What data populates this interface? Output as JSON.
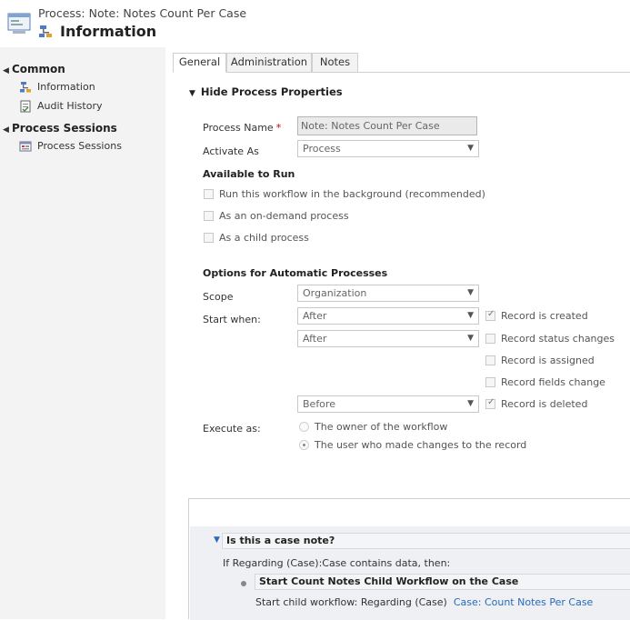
{
  "header": {
    "kicker": "Process: Note: Notes Count Per Case",
    "title": "Information"
  },
  "sidebar": {
    "groups": [
      {
        "label": "Common",
        "items": [
          {
            "label": "Information",
            "icon": "process-icon"
          },
          {
            "label": "Audit History",
            "icon": "audit-history-icon"
          }
        ]
      },
      {
        "label": "Process Sessions",
        "items": [
          {
            "label": "Process Sessions",
            "icon": "process-sessions-icon"
          }
        ]
      }
    ]
  },
  "tabs": [
    {
      "label": "General",
      "active": true
    },
    {
      "label": "Administration",
      "active": false
    },
    {
      "label": "Notes",
      "active": false
    }
  ],
  "form": {
    "section_toggle": "Hide Process Properties",
    "process_name_label": "Process Name",
    "process_name_value": "Note: Notes Count Per Case",
    "required_marker": "*",
    "activate_as_label": "Activate As",
    "activate_as_value": "Process",
    "available_to_run_heading": "Available to Run",
    "available_options": [
      {
        "label": "Run this workflow in the background (recommended)",
        "checked": false
      },
      {
        "label": "As an on-demand process",
        "checked": false
      },
      {
        "label": "As a child process",
        "checked": false
      }
    ],
    "options_heading": "Options for Automatic Processes",
    "scope_label": "Scope",
    "scope_value": "Organization",
    "start_when_label": "Start when:",
    "start_when": [
      {
        "select": "After",
        "trigger": "Record is created",
        "checked": true
      },
      {
        "select": "After",
        "trigger": "Record status changes",
        "checked": false
      },
      {
        "select": "",
        "trigger": "Record is assigned",
        "checked": false
      },
      {
        "select": "",
        "trigger": "Record fields change",
        "checked": false
      },
      {
        "select": "Before",
        "trigger": "Record is deleted",
        "checked": true
      }
    ],
    "execute_as_label": "Execute as:",
    "execute_as_options": [
      {
        "label": "The owner of the workflow",
        "selected": false
      },
      {
        "label": "The user who made changes to the record",
        "selected": true
      }
    ]
  },
  "designer": {
    "condition_title": "Is this a case note?",
    "condition_text": "If Regarding (Case):Case contains data, then:",
    "action_title": "Start Count Notes Child Workflow on the Case",
    "action_prefix": "Start child workflow:  Regarding (Case)",
    "action_link": "Case: Count Notes Per Case"
  },
  "colors": {
    "sidebar_bg": "#f3f3f3",
    "link": "#2a6ab8",
    "required": "#cc0000"
  }
}
